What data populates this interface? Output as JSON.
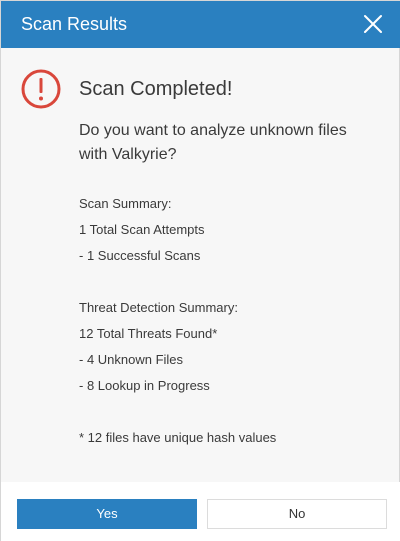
{
  "window": {
    "title": "Scan Results",
    "close_icon": "close-icon"
  },
  "content": {
    "alert_icon": "alert-circle-icon",
    "heading": "Scan Completed!",
    "question": "Do you want to analyze unknown files with Valkyrie?",
    "scan_summary": {
      "title": "Scan Summary:",
      "lines": [
        "1 Total Scan Attempts",
        "- 1 Successful Scans"
      ]
    },
    "threat_summary": {
      "title": "Threat Detection Summary:",
      "lines": [
        "12 Total Threats Found*",
        "- 4 Unknown Files",
        "- 8 Lookup in Progress"
      ]
    },
    "footnote": "* 12 files have unique hash values"
  },
  "buttons": {
    "yes": "Yes",
    "no": "No"
  },
  "colors": {
    "accent": "#2a80c0",
    "alert": "#d9473b"
  }
}
